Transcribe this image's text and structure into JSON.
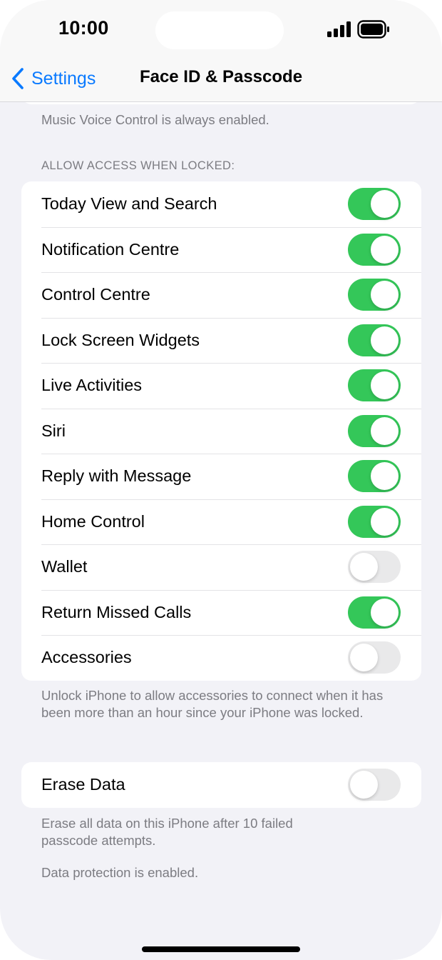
{
  "status_bar": {
    "time": "10:00"
  },
  "nav": {
    "back_label": "Settings",
    "title": "Face ID & Passcode"
  },
  "prior_footer": "Music Voice Control is always enabled.",
  "locked_section": {
    "header": "ALLOW ACCESS WHEN LOCKED:",
    "items": [
      {
        "label": "Today View and Search",
        "on": true
      },
      {
        "label": "Notification Centre",
        "on": true
      },
      {
        "label": "Control Centre",
        "on": true
      },
      {
        "label": "Lock Screen Widgets",
        "on": true
      },
      {
        "label": "Live Activities",
        "on": true
      },
      {
        "label": "Siri",
        "on": true
      },
      {
        "label": "Reply with Message",
        "on": true
      },
      {
        "label": "Home Control",
        "on": true
      },
      {
        "label": "Wallet",
        "on": false
      },
      {
        "label": "Return Missed Calls",
        "on": true
      },
      {
        "label": "Accessories",
        "on": false
      }
    ],
    "footer": "Unlock iPhone to allow accessories to connect when it has been more than an hour since your iPhone was locked."
  },
  "erase_section": {
    "label": "Erase Data",
    "on": false,
    "footer": "Erase all data on this iPhone after 10 failed passcode attempts.",
    "note": "Data protection is enabled."
  },
  "colors": {
    "accent": "#0a7aff",
    "toggle_on": "#34c759",
    "toggle_off": "#e9e9ea",
    "background": "#f2f2f7"
  }
}
